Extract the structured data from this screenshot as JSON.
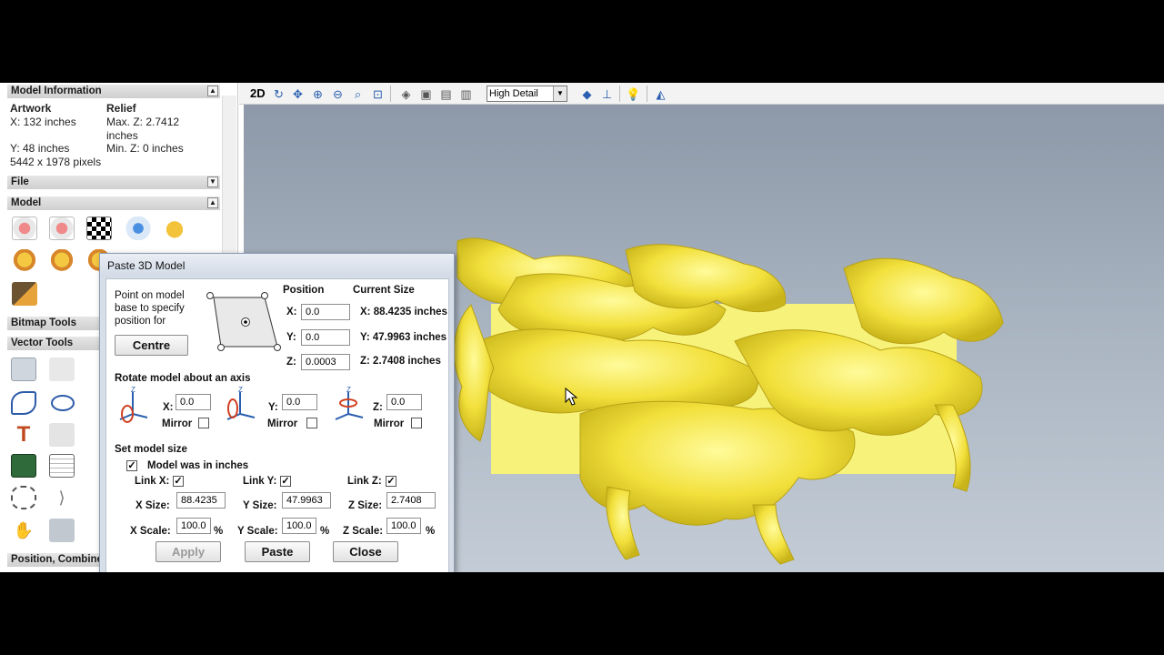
{
  "left_panel": {
    "model_info": {
      "header": "Model Information",
      "artwork_label": "Artwork",
      "relief_label": "Relief",
      "x_text": "X: 132 inches",
      "y_text": "Y: 48 inches",
      "pixels_text": "5442 x 1978 pixels",
      "maxz_text": "Max. Z: 2.7412",
      "maxz_unit": "inches",
      "minz_text": "Min. Z: 0 inches"
    },
    "sections": {
      "file": "File",
      "model": "Model",
      "bitmap_tools": "Bitmap Tools",
      "vector_tools": "Vector Tools",
      "position": "Position, Combine"
    }
  },
  "toolbar": {
    "mode_label": "2D",
    "detail_select": "High Detail"
  },
  "dialog": {
    "title": "Paste 3D Model",
    "point_label": "Point on model base to specify position for",
    "centre_button": "Centre",
    "position_header": "Position",
    "current_size_header": "Current Size",
    "pos": {
      "x_label": "X:",
      "x_value": "0.0",
      "y_label": "Y:",
      "y_value": "0.0",
      "z_label": "Z:",
      "z_value": "0.0003"
    },
    "size": {
      "x": "X: 88.4235 inches",
      "y": "Y: 47.9963 inches",
      "z": "Z: 2.7408 inches"
    },
    "rotate_header": "Rotate model about an axis",
    "rotate": {
      "x_label": "X:",
      "x_value": "0.0",
      "y_label": "Y:",
      "y_value": "0.0",
      "z_label": "Z:",
      "z_value": "0.0",
      "mirror_label": "Mirror"
    },
    "set_size_header": "Set model size",
    "inches_label": "Model was in inches",
    "link_x": "Link X:",
    "link_y": "Link Y:",
    "link_z": "Link Z:",
    "x_size_label": "X Size:",
    "x_size_value": "88.4235",
    "y_size_label": "Y Size:",
    "y_size_value": "47.9963",
    "z_size_label": "Z Size:",
    "z_size_value": "2.7408",
    "x_scale_label": "X Scale:",
    "x_scale_value": "100.0",
    "y_scale_label": "Y Scale:",
    "y_scale_value": "100.0",
    "z_scale_label": "Z Scale:",
    "z_scale_value": "100.0",
    "percent": "%",
    "apply_button": "Apply",
    "paste_button": "Paste",
    "close_button": "Close"
  }
}
